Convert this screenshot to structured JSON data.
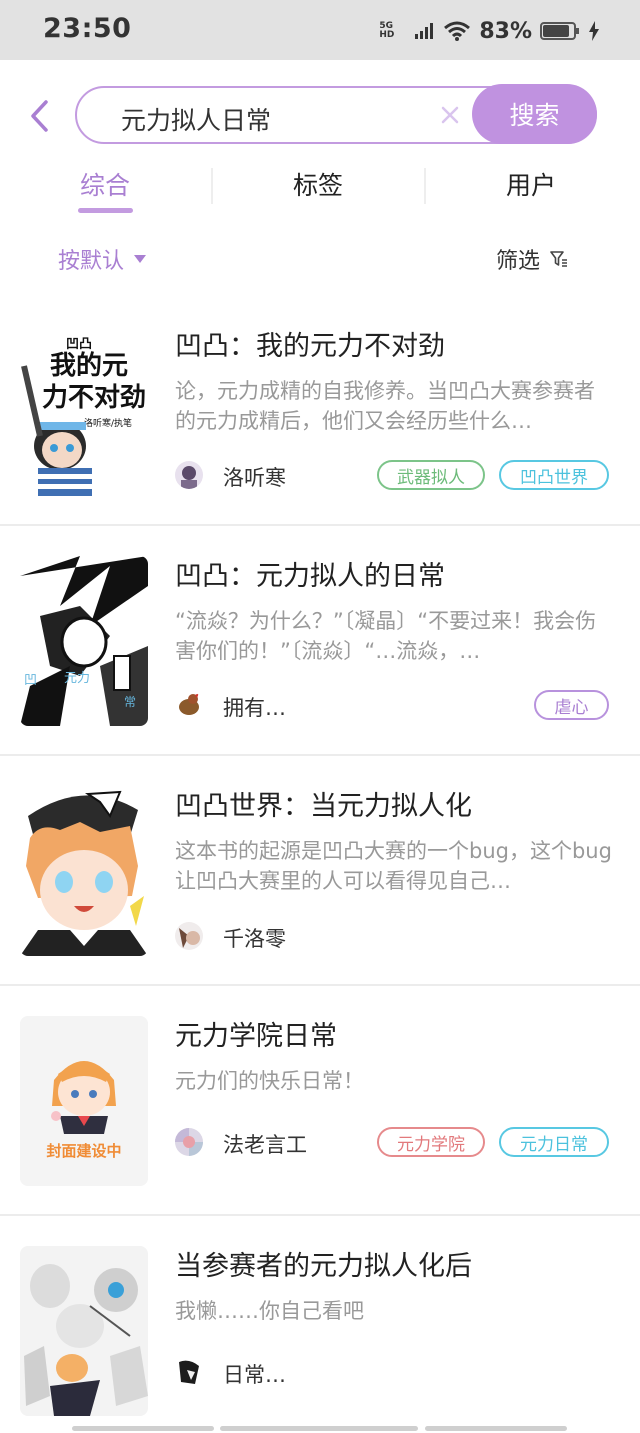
{
  "status_bar": {
    "time": "23:50",
    "network": "5G HD",
    "battery": "83%"
  },
  "search": {
    "query": "元力拟人日常",
    "button_label": "搜索"
  },
  "tabs": [
    {
      "label": "综合",
      "active": true
    },
    {
      "label": "标签",
      "active": false
    },
    {
      "label": "用户",
      "active": false
    }
  ],
  "sort": {
    "label": "按默认"
  },
  "filter": {
    "label": "筛选"
  },
  "results": [
    {
      "title": "凹凸：我的元力不对劲",
      "description": "论，元力成精的自我修养。当凹凸大赛参赛者的元力成精后，他们又会经历些什么…",
      "author": "洛听寒",
      "cover_text": [
        "凹凸",
        "我的元",
        "力不对劲",
        "洛听寒/执笔"
      ],
      "tags": [
        {
          "label": "武器拟人",
          "color": "green"
        },
        {
          "label": "凹凸世界",
          "color": "cyan"
        }
      ]
    },
    {
      "title": "凹凸：元力拟人的日常",
      "description": "“流焱？为什么？”〔凝晶〕“不要过来！我会伤害你们的！”〔流焱〕“…流焱，…",
      "author": "拥有…",
      "tags": [
        {
          "label": "虐心",
          "color": "purple"
        }
      ]
    },
    {
      "title": "凹凸世界：当元力拟人化",
      "description": "这本书的起源是凹凸大赛的一个bug，这个bug让凹凸大赛里的人可以看得见自己…",
      "author": "千洛零",
      "tags": []
    },
    {
      "title": "元力学院日常",
      "description": "元力们的快乐日常！",
      "author": "法老言工",
      "cover_text": [
        "封面建设中"
      ],
      "tags": [
        {
          "label": "元力学院",
          "color": "red"
        },
        {
          "label": "元力日常",
          "color": "cyan"
        }
      ]
    },
    {
      "title": "当参赛者的元力拟人化后",
      "description": "我懒……你自己看吧",
      "author": "日常…",
      "tags": []
    }
  ],
  "colors": {
    "accent": "#c092e0",
    "accent_text": "#a97fd2",
    "tag_green": "#6dbb7a",
    "tag_cyan": "#4cc2dd",
    "tag_red": "#e2797c"
  }
}
